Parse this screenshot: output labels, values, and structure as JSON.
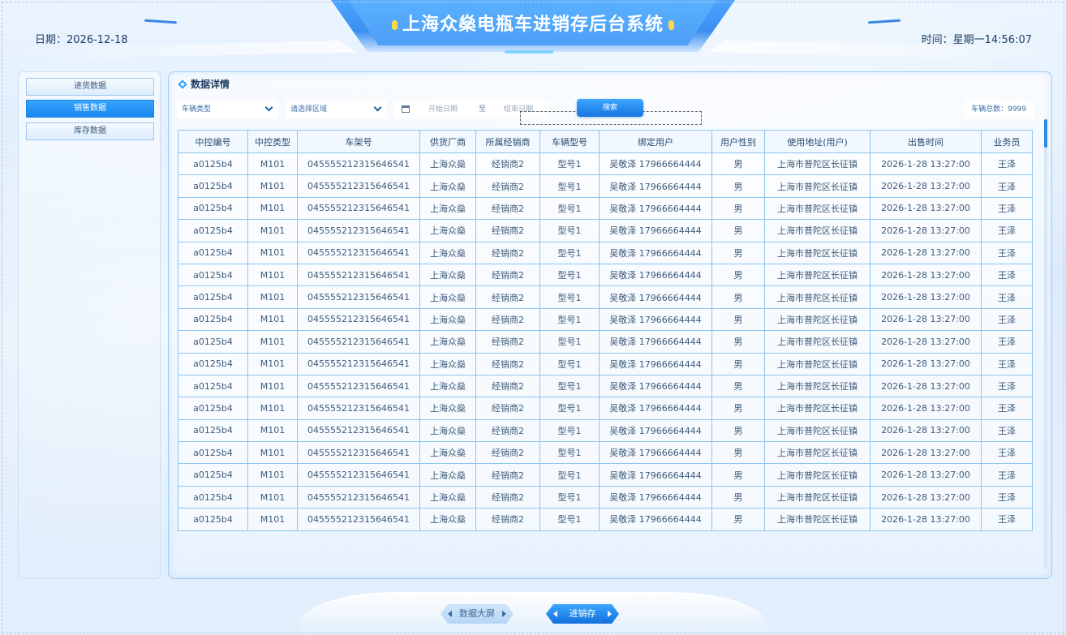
{
  "header": {
    "date_label": "日期：2026-12-18",
    "time_label": "时间：星期一14:56:07",
    "title": "上海众燊电瓶车进销存后台系统"
  },
  "sidebar": {
    "items": [
      {
        "label": "进货数据",
        "active": false
      },
      {
        "label": "销售数据",
        "active": true
      },
      {
        "label": "库存数据",
        "active": false
      }
    ]
  },
  "panel": {
    "title": "数据详情"
  },
  "filters": {
    "vehicle_type": "车辆类型",
    "region": "请选择区域",
    "start_date": "开始日期",
    "to": "至",
    "end_date": "结束日期",
    "search": "搜索",
    "total": "车辆总数：9999"
  },
  "table": {
    "columns": [
      "中控编号",
      "中控类型",
      "车架号",
      "供货厂商",
      "所属经销商",
      "车辆型号",
      "绑定用户",
      "用户性别",
      "使用地址(用户)",
      "出售时间",
      "业务员"
    ],
    "rows": [
      [
        "a0125b4",
        "M101",
        "045555212315646541",
        "上海众燊",
        "经销商2",
        "型号1",
        "吴敬泽 17966664444",
        "男",
        "上海市普陀区长征镇",
        "2026-1-28  13:27:00",
        "王泽"
      ],
      [
        "a0125b4",
        "M101",
        "045555212315646541",
        "上海众燊",
        "经销商2",
        "型号1",
        "吴敬泽 17966664444",
        "男",
        "上海市普陀区长征镇",
        "2026-1-28  13:27:00",
        "王泽"
      ],
      [
        "a0125b4",
        "M101",
        "045555212315646541",
        "上海众燊",
        "经销商2",
        "型号1",
        "吴敬泽 17966664444",
        "男",
        "上海市普陀区长征镇",
        "2026-1-28  13:27:00",
        "王泽"
      ],
      [
        "a0125b4",
        "M101",
        "045555212315646541",
        "上海众燊",
        "经销商2",
        "型号1",
        "吴敬泽 17966664444",
        "男",
        "上海市普陀区长征镇",
        "2026-1-28  13:27:00",
        "王泽"
      ],
      [
        "a0125b4",
        "M101",
        "045555212315646541",
        "上海众燊",
        "经销商2",
        "型号1",
        "吴敬泽 17966664444",
        "男",
        "上海市普陀区长征镇",
        "2026-1-28  13:27:00",
        "王泽"
      ],
      [
        "a0125b4",
        "M101",
        "045555212315646541",
        "上海众燊",
        "经销商2",
        "型号1",
        "吴敬泽 17966664444",
        "男",
        "上海市普陀区长征镇",
        "2026-1-28  13:27:00",
        "王泽"
      ],
      [
        "a0125b4",
        "M101",
        "045555212315646541",
        "上海众燊",
        "经销商2",
        "型号1",
        "吴敬泽 17966664444",
        "男",
        "上海市普陀区长征镇",
        "2026-1-28  13:27:00",
        "王泽"
      ],
      [
        "a0125b4",
        "M101",
        "045555212315646541",
        "上海众燊",
        "经销商2",
        "型号1",
        "吴敬泽 17966664444",
        "男",
        "上海市普陀区长征镇",
        "2026-1-28  13:27:00",
        "王泽"
      ],
      [
        "a0125b4",
        "M101",
        "045555212315646541",
        "上海众燊",
        "经销商2",
        "型号1",
        "吴敬泽 17966664444",
        "男",
        "上海市普陀区长征镇",
        "2026-1-28  13:27:00",
        "王泽"
      ],
      [
        "a0125b4",
        "M101",
        "045555212315646541",
        "上海众燊",
        "经销商2",
        "型号1",
        "吴敬泽 17966664444",
        "男",
        "上海市普陀区长征镇",
        "2026-1-28  13:27:00",
        "王泽"
      ],
      [
        "a0125b4",
        "M101",
        "045555212315646541",
        "上海众燊",
        "经销商2",
        "型号1",
        "吴敬泽 17966664444",
        "男",
        "上海市普陀区长征镇",
        "2026-1-28  13:27:00",
        "王泽"
      ],
      [
        "a0125b4",
        "M101",
        "045555212315646541",
        "上海众燊",
        "经销商2",
        "型号1",
        "吴敬泽 17966664444",
        "男",
        "上海市普陀区长征镇",
        "2026-1-28  13:27:00",
        "王泽"
      ],
      [
        "a0125b4",
        "M101",
        "045555212315646541",
        "上海众燊",
        "经销商2",
        "型号1",
        "吴敬泽 17966664444",
        "男",
        "上海市普陀区长征镇",
        "2026-1-28  13:27:00",
        "王泽"
      ],
      [
        "a0125b4",
        "M101",
        "045555212315646541",
        "上海众燊",
        "经销商2",
        "型号1",
        "吴敬泽 17966664444",
        "男",
        "上海市普陀区长征镇",
        "2026-1-28  13:27:00",
        "王泽"
      ],
      [
        "a0125b4",
        "M101",
        "045555212315646541",
        "上海众燊",
        "经销商2",
        "型号1",
        "吴敬泽 17966664444",
        "男",
        "上海市普陀区长征镇",
        "2026-1-28  13:27:00",
        "王泽"
      ],
      [
        "a0125b4",
        "M101",
        "045555212315646541",
        "上海众燊",
        "经销商2",
        "型号1",
        "吴敬泽 17966664444",
        "男",
        "上海市普陀区长征镇",
        "2026-1-28  13:27:00",
        "王泽"
      ],
      [
        "a0125b4",
        "M101",
        "045555212315646541",
        "上海众燊",
        "经销商2",
        "型号1",
        "吴敬泽 17966664444",
        "男",
        "上海市普陀区长征镇",
        "2026-1-28  13:27:00",
        "王泽"
      ]
    ]
  },
  "bottom_nav": {
    "items": [
      {
        "label": "数据大屏",
        "active": false
      },
      {
        "label": "进销存",
        "active": true
      }
    ]
  },
  "colors": {
    "accent": "#1a86ee",
    "title_bg": "#4aa4ff",
    "table_border": "#8cc5f0",
    "title_dot": "#ffd84a"
  }
}
